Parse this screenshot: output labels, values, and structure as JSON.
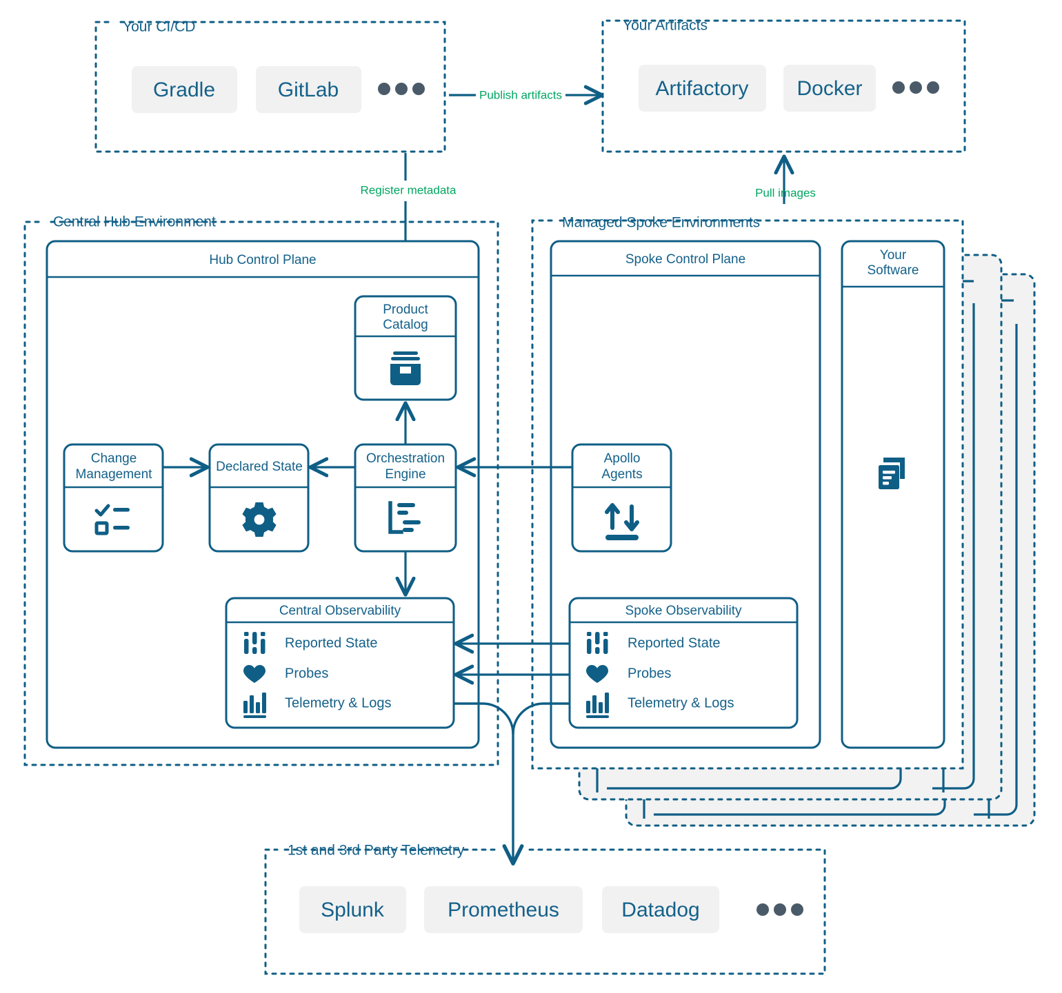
{
  "colors": {
    "stroke": "#0f5e85",
    "text_blue": "#14618a",
    "edge_label_green": "#00a661",
    "pill_fill": "#f1f1f1",
    "stack_fill": "#f2f2f2",
    "dot_gray": "#4a5a68",
    "white": "#ffffff"
  },
  "groups": {
    "ci_cd": {
      "title": "Your CI/CD",
      "items": [
        "Gradle",
        "GitLab"
      ],
      "ellipsis": "more-dots-icon"
    },
    "artifacts": {
      "title": "Your Artifacts",
      "items": [
        "Artifactory",
        "Docker"
      ],
      "ellipsis": "more-dots-icon"
    },
    "central_hub": {
      "title": "Central Hub Environment",
      "control_plane": {
        "title": "Hub Control Plane",
        "nodes": [
          {
            "title_line1": "Product",
            "title_line2": "Catalog",
            "icon": "archive-box-icon"
          },
          {
            "title_line1": "Change",
            "title_line2": "Management",
            "icon": "checklist-icon"
          },
          {
            "title_line1": "Declared State",
            "title_line2": "",
            "icon": "gear-icon"
          },
          {
            "title_line1": "Orchestration",
            "title_line2": "Engine",
            "icon": "hierarchy-tree-icon"
          }
        ],
        "observability": {
          "title": "Central Observability",
          "rows": [
            {
              "label": "Reported State",
              "icon": "sliders-icon"
            },
            {
              "label": "Probes",
              "icon": "heart-icon"
            },
            {
              "label": "Telemetry & Logs",
              "icon": "bar-chart-icon"
            }
          ]
        }
      }
    },
    "managed_spokes": {
      "title": "Managed Spoke Environments",
      "control_plane": {
        "title": "Spoke Control Plane",
        "nodes": [
          {
            "title_line1": "Apollo",
            "title_line2": "Agents",
            "icon": "up-down-arrows-icon"
          }
        ],
        "observability": {
          "title": "Spoke Observability",
          "rows": [
            {
              "label": "Reported State",
              "icon": "sliders-icon"
            },
            {
              "label": "Probes",
              "icon": "heart-icon"
            },
            {
              "label": "Telemetry & Logs",
              "icon": "bar-chart-icon"
            }
          ]
        }
      },
      "your_software": {
        "title_line1": "Your",
        "title_line2": "Software",
        "icon": "copy-documents-icon"
      },
      "stack_count": 2
    },
    "telemetry": {
      "title": "1st and 3rd Party Telemetry",
      "items": [
        "Splunk",
        "Prometheus",
        "Datadog"
      ],
      "ellipsis": "more-dots-icon"
    }
  },
  "edges": [
    {
      "label": "Publish artifacts",
      "from": "ci-cd",
      "to": "artifacts"
    },
    {
      "label": "Register metadata",
      "from": "ci-cd",
      "to": "product-catalog"
    },
    {
      "label": "Pull images",
      "from": "spoke-control-plane",
      "to": "artifacts"
    }
  ]
}
